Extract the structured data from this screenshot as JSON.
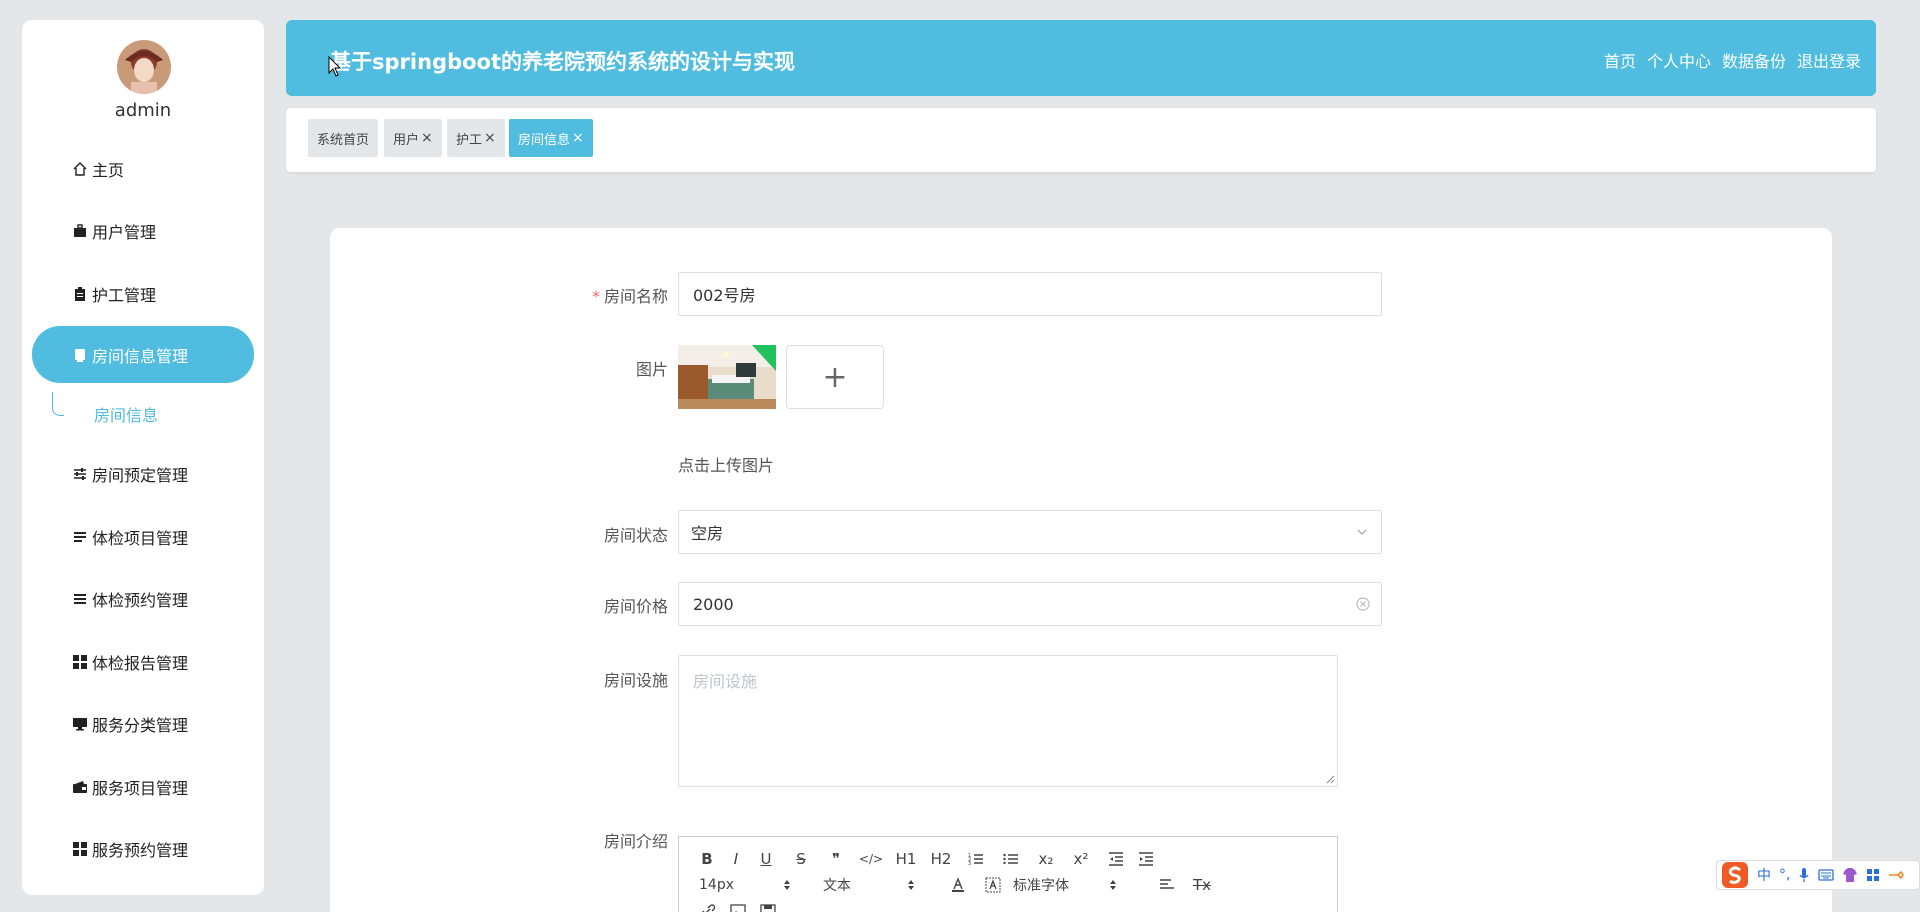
{
  "user": {
    "name": "admin"
  },
  "sidebar": {
    "items": [
      {
        "label": "主页",
        "icon": "home-icon"
      },
      {
        "label": "用户管理",
        "icon": "briefcase-icon"
      },
      {
        "label": "护工管理",
        "icon": "clipboard-icon"
      },
      {
        "label": "房间信息管理",
        "icon": "tablet-icon",
        "active": true
      },
      {
        "label": "房间预定管理",
        "icon": "sliders-icon"
      },
      {
        "label": "体检项目管理",
        "icon": "list-icon"
      },
      {
        "label": "体检预约管理",
        "icon": "list-icon"
      },
      {
        "label": "体检报告管理",
        "icon": "grid-icon"
      },
      {
        "label": "服务分类管理",
        "icon": "monitor-icon"
      },
      {
        "label": "服务项目管理",
        "icon": "wallet-icon"
      },
      {
        "label": "服务预约管理",
        "icon": "grid-icon"
      }
    ],
    "submenu": {
      "label": "房间信息"
    }
  },
  "header": {
    "title": "基于springboot的养老院预约系统的设计与实现",
    "nav": [
      "首页",
      "个人中心",
      "数据备份",
      "退出登录"
    ]
  },
  "tabs": [
    {
      "label": "系统首页",
      "closable": false
    },
    {
      "label": "用户",
      "closable": true
    },
    {
      "label": "护工",
      "closable": true
    },
    {
      "label": "房间信息",
      "closable": true,
      "active": true
    }
  ],
  "tab_close_glyph": "×",
  "form": {
    "room_name": {
      "label": "房间名称",
      "required_mark": "*",
      "value": "002号房"
    },
    "image": {
      "label": "图片",
      "upload_hint": "点击上传图片",
      "add_glyph": "+"
    },
    "room_status": {
      "label": "房间状态",
      "value": "空房"
    },
    "room_price": {
      "label": "房间价格",
      "value": "2000"
    },
    "facilities": {
      "label": "房间设施",
      "placeholder": "房间设施"
    },
    "intro": {
      "label": "房间介绍"
    }
  },
  "editor": {
    "font_size": "14px",
    "text_type": "文本",
    "font_family": "标准字体",
    "buttons": {
      "bold": "B",
      "italic": "I",
      "underline": "U",
      "strike": "S",
      "quote": "❞",
      "code": "</>",
      "h1": "H1",
      "h2": "H2",
      "sub": "x₂",
      "sup": "x²",
      "clear": "Tx"
    }
  },
  "ime": {
    "chinese": "中",
    "punct": "°,"
  },
  "colors": {
    "primary": "#50bde0",
    "bg": "#e4e7e9"
  }
}
